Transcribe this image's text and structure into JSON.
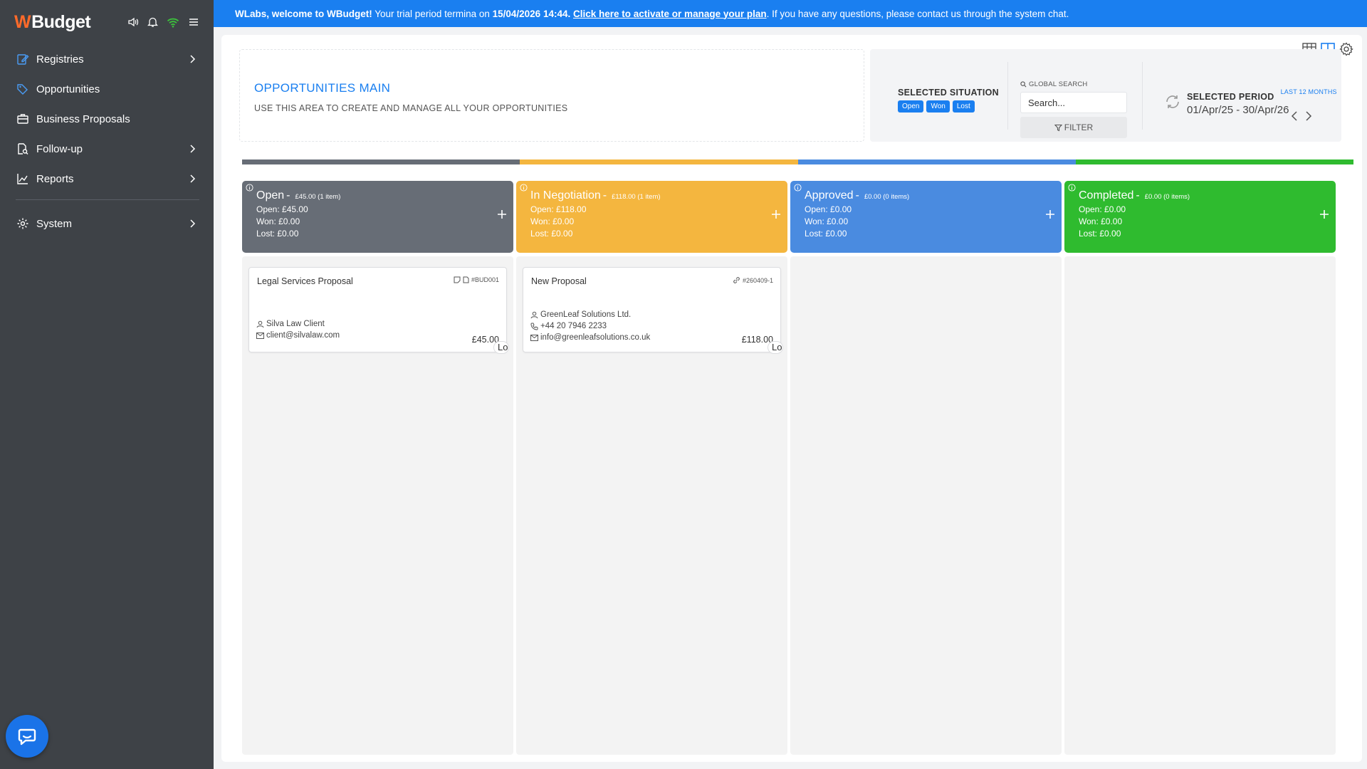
{
  "app": {
    "logo_mark": "W",
    "logo_text": "Budget",
    "top_icons": [
      "speaker-icon",
      "bell-icon",
      "wifi-icon",
      "menu-icon"
    ]
  },
  "sidebar": {
    "items": [
      {
        "label": "Registries",
        "icon": "edit-icon",
        "has_chevron": true
      },
      {
        "label": "Opportunities",
        "icon": "tag-icon",
        "has_chevron": false
      },
      {
        "label": "Business Proposals",
        "icon": "briefcase-icon",
        "has_chevron": false
      },
      {
        "label": "Follow-up",
        "icon": "document-search-icon",
        "has_chevron": true
      },
      {
        "label": "Reports",
        "icon": "chart-icon",
        "has_chevron": true
      },
      {
        "label": "System",
        "icon": "gear-icon",
        "has_chevron": true
      }
    ]
  },
  "banner": {
    "greeting": "WLabs, welcome to WBudget!",
    "text1": " Your trial period termina on ",
    "date": "15/04/2026 14:44.",
    "space": " ",
    "link": "Click here to activate or manage your plan",
    "text2": ". If you have any questions, please contact us through the system chat."
  },
  "header": {
    "title": "OPPORTUNITIES MAIN",
    "subtitle": "USE THIS AREA TO CREATE AND MANAGE ALL YOUR OPPORTUNITIES"
  },
  "filters": {
    "situation_title": "SELECTED SITUATION",
    "situation_pills": [
      "Open",
      "Won",
      "Lost"
    ],
    "search_label": "GLOBAL SEARCH",
    "search_placeholder": "Search...",
    "filter_label": "FILTER",
    "period_title": "SELECTED PERIOD",
    "period_badge": "LAST 12 MONTHS",
    "period_range": "01/Apr/25 - 30/Apr/26"
  },
  "colors": {
    "accent": "#1a7ff0",
    "open": "#676d76",
    "negotiation": "#f4b63f",
    "approved": "#4a8be0",
    "completed": "#2fbb2f"
  },
  "columns": [
    {
      "title": "Open",
      "summary": "£45.00 (1 item)",
      "open": "Open: £45.00",
      "won": "Won: £0.00",
      "lost": "Lost: £0.00",
      "cards": [
        {
          "title": "Legal Services Proposal",
          "ref": "#BUD001",
          "line1": "Silva Law Client",
          "line2": "client@silvalaw.com",
          "amount": "£45.00",
          "tag": "Lo"
        }
      ]
    },
    {
      "title": "In Negotiation",
      "summary": "£118.00 (1 item)",
      "open": "Open: £118.00",
      "won": "Won: £0.00",
      "lost": "Lost: £0.00",
      "cards": [
        {
          "title": "New Proposal",
          "ref": "#260409-1",
          "line1": "GreenLeaf Solutions Ltd.",
          "line2": "+44 20 7946 2233",
          "line3": "info@greenleafsolutions.co.uk",
          "amount": "£118.00",
          "tag": "Lo"
        }
      ]
    },
    {
      "title": "Approved",
      "summary": "£0.00 (0 items)",
      "open": "Open: £0.00",
      "won": "Won: £0.00",
      "lost": "Lost: £0.00",
      "cards": []
    },
    {
      "title": "Completed",
      "summary": "£0.00 (0 items)",
      "open": "Open: £0.00",
      "won": "Won: £0.00",
      "lost": "Lost: £0.00",
      "cards": []
    }
  ]
}
